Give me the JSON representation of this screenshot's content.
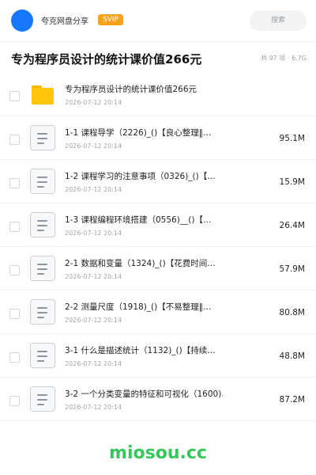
{
  "header": {
    "brand": "夸克网盘分享",
    "badge": "SVIP",
    "search_label": "搜索"
  },
  "folder": {
    "title": "专为程序员设计的统计课价值266元",
    "meta": "共 97 项 · 6.7G"
  },
  "items": [
    {
      "type": "folder",
      "name": "专为程序员设计的统计课价值266元",
      "date": "2026-07-12 20:14",
      "size": ""
    },
    {
      "type": "file",
      "name": "1-1 课程导学（2226)_()【良心整理‖…",
      "date": "2026-07-12 20:14",
      "size": "95.1M"
    },
    {
      "type": "file",
      "name": "1-2 课程学习的注意事项（0326)_()【…",
      "date": "2026-07-12 20:14",
      "size": "15.9M"
    },
    {
      "type": "file",
      "name": "1-3 课程编程环境搭建（0556)__()【…",
      "date": "2026-07-12 20:14",
      "size": "26.4M"
    },
    {
      "type": "file",
      "name": "2-1 数据和变量（1324)_()【花费时间…",
      "date": "2026-07-12 20:14",
      "size": "57.9M"
    },
    {
      "type": "file",
      "name": "2-2 测量尺度（1918)_()【不易整理‖…",
      "date": "2026-07-12 20:14",
      "size": "80.8M"
    },
    {
      "type": "file",
      "name": "3-1 什么是描述统计（1132)_()【持续…",
      "date": "2026-07-12 20:14",
      "size": "48.8M"
    },
    {
      "type": "file",
      "name": "3-2 一个分类变量的特征和可视化（1600)…",
      "date": "2026-07-12 20:14",
      "size": "87.2M"
    }
  ],
  "watermark": "miosou.cc",
  "colors": {
    "accent": "#1677ff",
    "svip": "#f6a21a",
    "folder": "#ffc60b",
    "watermark": "#34c759"
  }
}
